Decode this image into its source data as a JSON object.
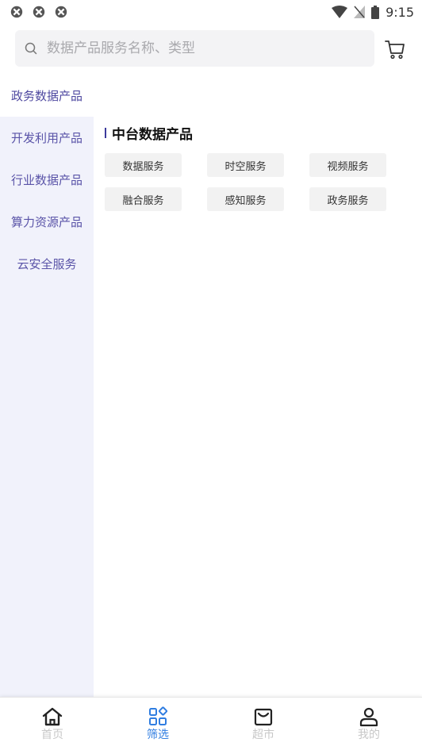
{
  "status_bar": {
    "time": "9:15"
  },
  "search": {
    "placeholder": "数据产品服务名称、类型"
  },
  "sidebar": {
    "items": [
      {
        "label": "政务数据产品"
      },
      {
        "label": "开发利用产品"
      },
      {
        "label": "行业数据产品"
      },
      {
        "label": "算力资源产品"
      },
      {
        "label": "云安全服务"
      }
    ]
  },
  "content": {
    "section_title": "中台数据产品",
    "chips": [
      {
        "label": "数据服务"
      },
      {
        "label": "时空服务"
      },
      {
        "label": "视频服务"
      },
      {
        "label": "融合服务"
      },
      {
        "label": "感知服务"
      },
      {
        "label": "政务服务"
      }
    ]
  },
  "bottom_nav": {
    "items": [
      {
        "label": "首页",
        "icon": "home-icon"
      },
      {
        "label": "筛选",
        "icon": "grid-filter-icon"
      },
      {
        "label": "超市",
        "icon": "shopping-bag-icon"
      },
      {
        "label": "我的",
        "icon": "user-icon"
      }
    ],
    "active_color": "#2f7de1"
  }
}
